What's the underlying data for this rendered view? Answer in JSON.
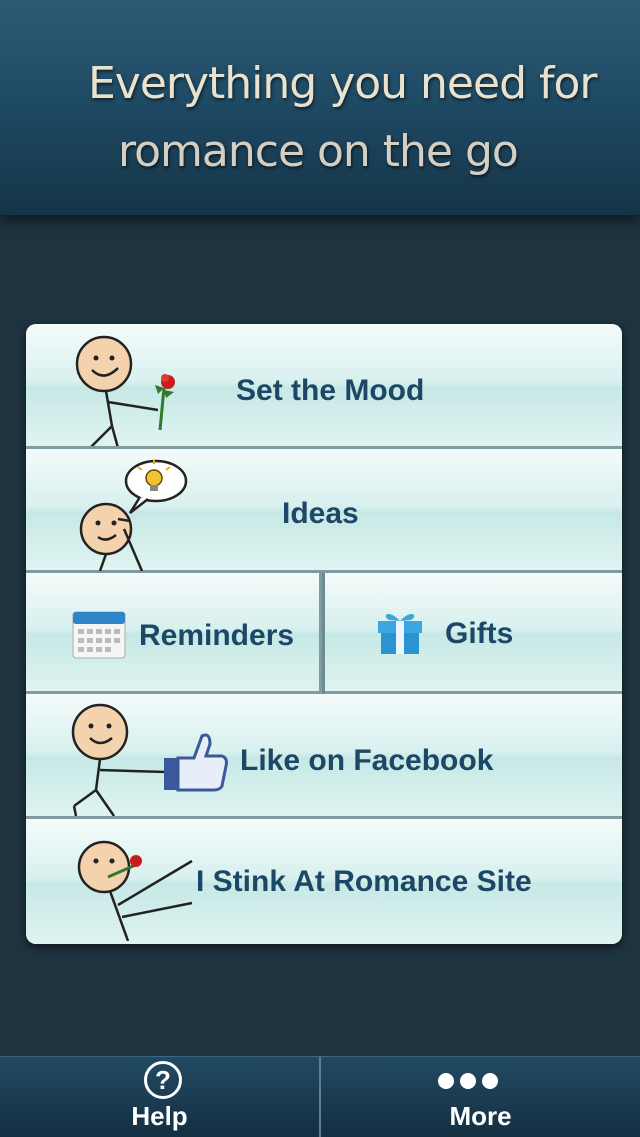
{
  "header": {
    "line1": "Everything you need for",
    "line2": "romance on the go"
  },
  "menu": {
    "set_the_mood": "Set the Mood",
    "ideas": "Ideas",
    "reminders": "Reminders",
    "gifts": "Gifts",
    "like_facebook": "Like on Facebook",
    "site": "I Stink At Romance Site"
  },
  "icons": {
    "set_the_mood": "stick-figure-with-rose",
    "ideas": "stick-figure-with-lightbulb-thought",
    "reminders": "calendar-icon",
    "gifts": "gift-box-icon",
    "like_facebook": "stick-figure-with-thumbs-up",
    "site": "stick-figure-holding-rose-in-mouth"
  },
  "tabbar": {
    "help_label": "Help",
    "help_icon": "?",
    "more_label": "More"
  },
  "colors": {
    "background": "#1f3441",
    "header": "#1f4b65",
    "button_text": "#1d4766",
    "button_face": "#d7f0ee"
  }
}
